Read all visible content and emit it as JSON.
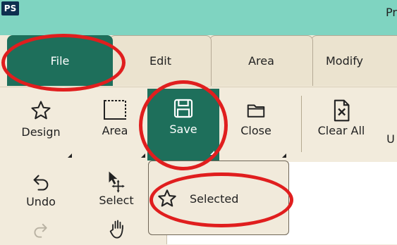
{
  "app": {
    "logo_text": "PS",
    "title_partial": "Pr"
  },
  "tabs": [
    {
      "label": "File",
      "active": true
    },
    {
      "label": "Edit"
    },
    {
      "label": "Area"
    },
    {
      "label": "Modify"
    }
  ],
  "ribbon": {
    "design_label": "Design",
    "area_label": "Area",
    "save_label": "Save",
    "close_label": "Close",
    "clear_all_label": "Clear All",
    "cut_off_label": "U",
    "undo_label": "Undo",
    "select_label": "Select"
  },
  "save_dropdown": {
    "items": [
      {
        "label": "Selected",
        "icon": "star-icon"
      }
    ]
  },
  "icons": {
    "design": "star-outline-icon",
    "area": "dashed-rectangle-icon",
    "save": "floppy-disk-icon",
    "close": "folder-icon",
    "clear_all": "document-x-icon",
    "undo": "undo-arrow-icon",
    "select": "arrow-move-icon",
    "redo": "redo-arrow-icon",
    "pan": "hand-icon"
  },
  "colors": {
    "title_bar": "#7fd4c1",
    "active_tab": "#1e6f5b",
    "ribbon_bg": "#f2ebdc",
    "annotation": "#e01e1e"
  }
}
